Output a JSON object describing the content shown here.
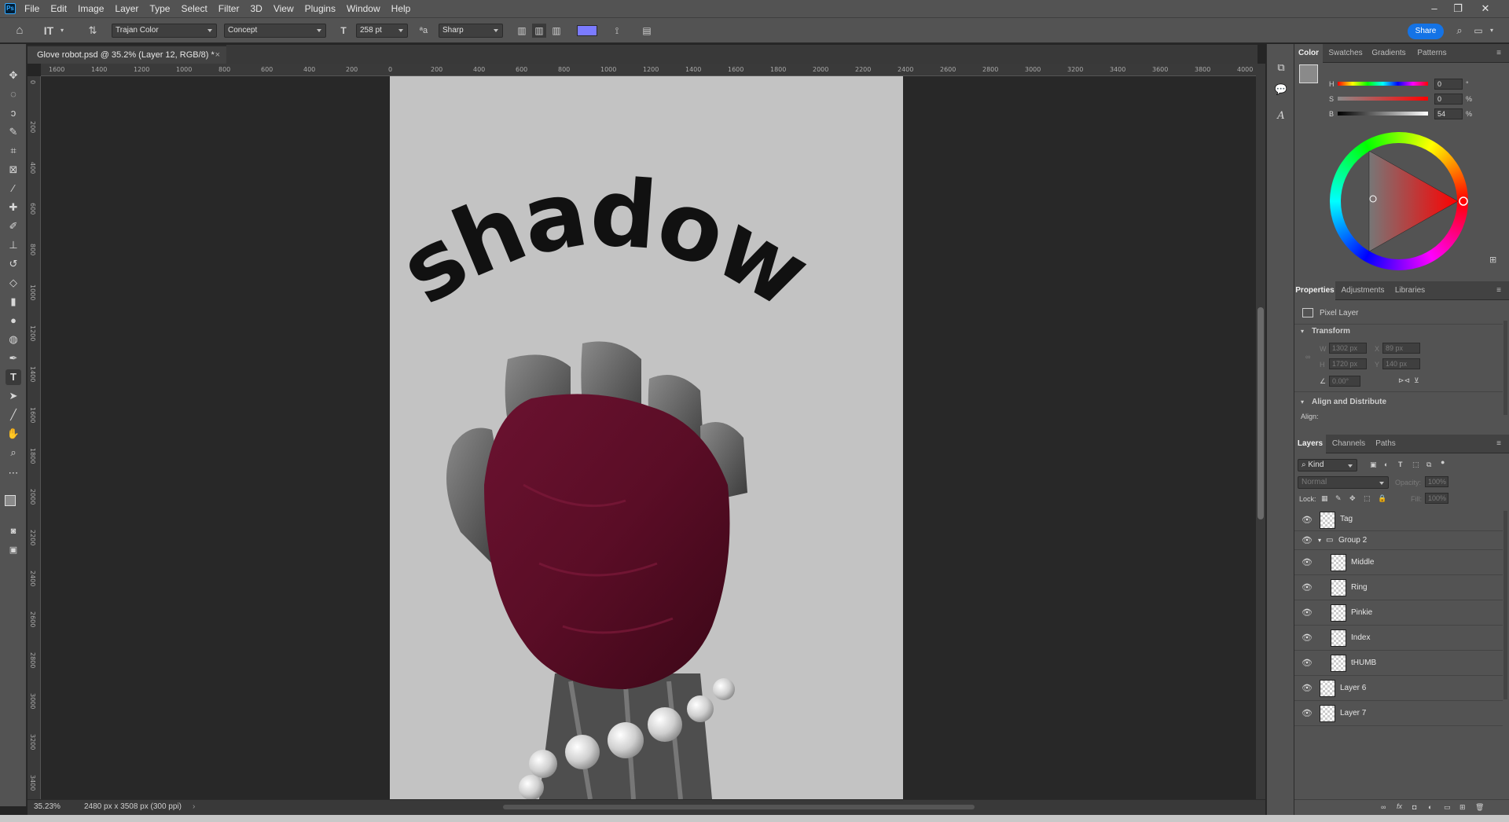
{
  "app": {
    "logo": "Ps"
  },
  "menu": [
    "File",
    "Edit",
    "Image",
    "Layer",
    "Type",
    "Select",
    "Filter",
    "3D",
    "View",
    "Plugins",
    "Window",
    "Help"
  ],
  "options": {
    "font_family": "Trajan Color",
    "font_style": "Concept",
    "font_size": "258 pt",
    "antialias": "Sharp",
    "text_color": "#7b7bff",
    "share": "Share"
  },
  "document": {
    "tab_title": "Glove robot.psd @ 35.2% (Layer 12, RGB/8) *",
    "zoom": "35.23%",
    "dimensions": "2480 px x 3508 px (300 ppi)",
    "artwork_text": "shadow"
  },
  "ruler": {
    "h_ticks": [
      "1600",
      "1400",
      "1200",
      "1000",
      "800",
      "600",
      "400",
      "200",
      "0",
      "200",
      "400",
      "600",
      "800",
      "1000",
      "1200",
      "1400",
      "1600",
      "1800",
      "2000",
      "2200",
      "2400",
      "2600",
      "2800",
      "3000",
      "3200",
      "3400",
      "3600",
      "3800",
      "4000"
    ],
    "v_ticks": [
      "0",
      "200",
      "400",
      "600",
      "800",
      "1000",
      "1200",
      "1400",
      "1600",
      "1800",
      "2000",
      "2200",
      "2400",
      "2600",
      "2800",
      "3000",
      "3200",
      "3400"
    ]
  },
  "color_panel": {
    "tabs": [
      "Color",
      "Swatches",
      "Gradients",
      "Patterns"
    ],
    "h": {
      "label": "H",
      "value": "0",
      "unit": "°"
    },
    "s": {
      "label": "S",
      "value": "0",
      "unit": "%"
    },
    "b": {
      "label": "B",
      "value": "54",
      "unit": "%"
    },
    "foreground": "#8a8a8a"
  },
  "properties_panel": {
    "tabs": [
      "Properties",
      "Adjustments",
      "Libraries"
    ],
    "layer_type": "Pixel Layer",
    "transform_label": "Transform",
    "w": {
      "label": "W",
      "value": "1302 px"
    },
    "h": {
      "label": "H",
      "value": "1720 px"
    },
    "x": {
      "label": "X",
      "value": "89 px"
    },
    "y": {
      "label": "Y",
      "value": "140 px"
    },
    "angle": "0.00°",
    "align_label": "Align and Distribute",
    "align_sub": "Align:"
  },
  "layers_panel": {
    "tabs": [
      "Layers",
      "Channels",
      "Paths"
    ],
    "filter": "Kind",
    "blend": "Normal",
    "opacity_label": "Opacity:",
    "opacity": "100%",
    "lock_label": "Lock:",
    "fill_label": "Fill:",
    "fill": "100%",
    "layers": [
      {
        "name": "Tag"
      },
      {
        "name": "Group 2"
      },
      {
        "name": "Middle"
      },
      {
        "name": "Ring"
      },
      {
        "name": "Pinkie"
      },
      {
        "name": "Index"
      },
      {
        "name": "tHUMB"
      },
      {
        "name": "Layer 6"
      },
      {
        "name": "Layer 7"
      }
    ]
  }
}
